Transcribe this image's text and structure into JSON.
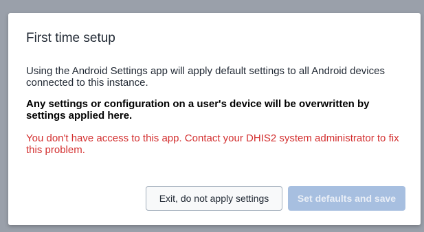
{
  "dialog": {
    "title": "First time setup",
    "description": "Using the Android Settings app will apply default settings to all Android devices connected to this instance.",
    "warning": "Any settings or configuration on a user's device will be overwritten by settings applied here.",
    "error": "You don't have access to this app. Contact your DHIS2 system administrator to fix this problem.",
    "exit_label": "Exit, do not apply settings",
    "save_label": "Set defaults and save",
    "save_disabled": true
  },
  "colors": {
    "overlay": "#9aa0aa",
    "error_text": "#d32f2f",
    "primary_disabled": "#a7bfe0"
  }
}
